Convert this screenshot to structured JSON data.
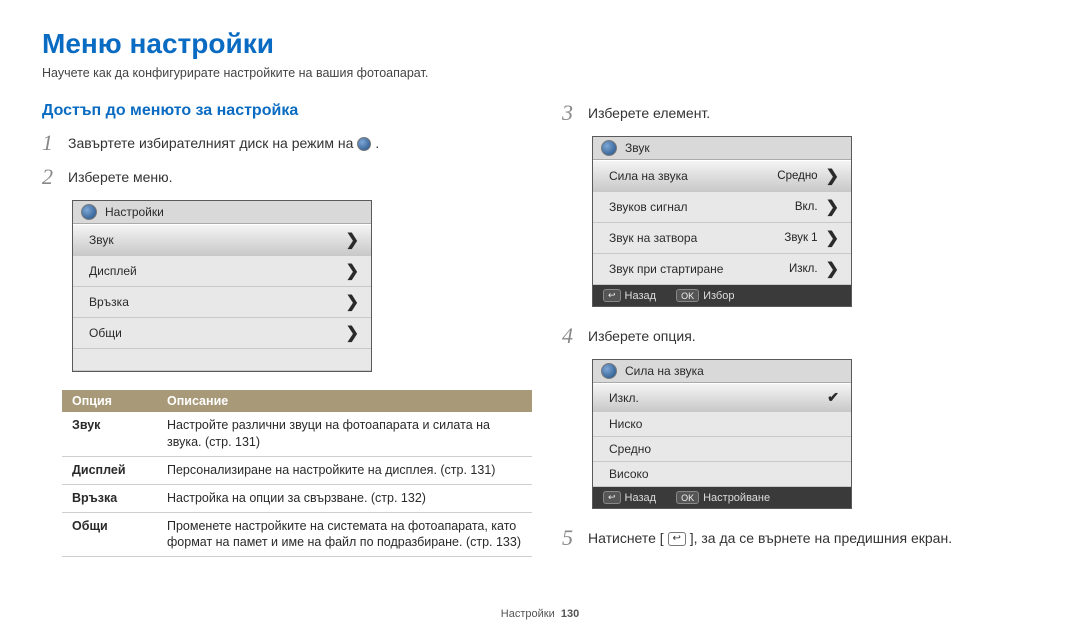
{
  "title": "Меню настройки",
  "subtitle": "Научете как да конфигурирате настройките на вашия фотоапарат.",
  "section_title": "Достъп до менюто за настройка",
  "steps": {
    "s1": "Завъртете избирателният диск на режим на",
    "s1_end": ".",
    "s2": "Изберете меню.",
    "s3": "Изберете елемент.",
    "s4": "Изберете опция.",
    "s5_a": "Натиснете [",
    "s5_b": "], за да се върнете на предишния екран."
  },
  "menu1": {
    "header": "Настройки",
    "items": [
      "Звук",
      "Дисплей",
      "Връзка",
      "Общи"
    ]
  },
  "menu2": {
    "header": "Звук",
    "rows": [
      {
        "label": "Сила на звука",
        "value": "Средно"
      },
      {
        "label": "Звуков сигнал",
        "value": "Вкл."
      },
      {
        "label": "Звук на затвора",
        "value": "Звук 1"
      },
      {
        "label": "Звук при стартиране",
        "value": "Изкл."
      }
    ],
    "footer_back": "Назад",
    "footer_ok": "Избор"
  },
  "menu3": {
    "header": "Сила на звука",
    "rows": [
      "Изкл.",
      "Ниско",
      "Средно",
      "Високо"
    ],
    "selected_index": 0,
    "footer_back": "Назад",
    "footer_ok": "Настройване"
  },
  "table": {
    "head_option": "Опция",
    "head_desc": "Описание",
    "rows": [
      {
        "opt": "Звук",
        "desc": "Настройте различни звуци на фотоапарата и силата на звука. (стр. 131)"
      },
      {
        "opt": "Дисплей",
        "desc": "Персонализиране на настройките на дисплея. (стр. 131)"
      },
      {
        "opt": "Връзка",
        "desc": "Настройка на опции за свързване. (стр. 132)"
      },
      {
        "opt": "Общи",
        "desc": "Променете настройките на системата на фотоапарата, като формат на памет и име на файл по подразбиране. (стр. 133)"
      }
    ]
  },
  "footer": {
    "section": "Настройки",
    "page": "130"
  },
  "keys": {
    "back_icon": "↩",
    "ok": "OK"
  }
}
